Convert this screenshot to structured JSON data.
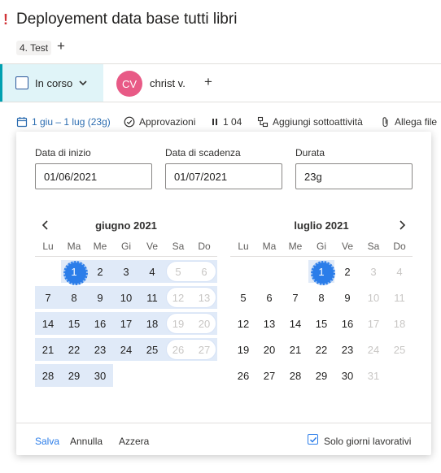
{
  "header": {
    "priority_mark": "!",
    "title": "Deployement data base tutti libri",
    "tag": "4. Test",
    "add_tag": "+"
  },
  "status": {
    "label": "In corso"
  },
  "assignee": {
    "initials": "CV",
    "name": "christ v.",
    "add": "+",
    "avatar_color": "#e85a86"
  },
  "toolbar": {
    "dates": "1 giu – 1 lug (23g)",
    "approvals": "Approvazioni",
    "count": "1 04",
    "add_subtask": "Aggiungi sottoattività",
    "attach": "Allega file"
  },
  "date_picker": {
    "start_label": "Data di inizio",
    "start_value": "01/06/2021",
    "due_label": "Data di scadenza",
    "due_value": "01/07/2021",
    "duration_label": "Durata",
    "duration_value": "23g",
    "weekdays": [
      "Lu",
      "Ma",
      "Me",
      "Gi",
      "Ve",
      "Sa",
      "Do"
    ],
    "months": [
      {
        "title": "giugno 2021",
        "first_weekday": 1,
        "days": 30,
        "days_in_prev_month": 0
      },
      {
        "title": "luglio 2021",
        "first_weekday": 3,
        "days": 31
      }
    ],
    "range": {
      "start": "2021-06-01",
      "end": "2021-07-01"
    },
    "footer": {
      "save": "Salva",
      "cancel": "Annulla",
      "reset": "Azzera",
      "workdays_only": "Solo giorni lavorativi",
      "workdays_checked": true
    }
  },
  "colors": {
    "accent": "#2b7de9",
    "range_fill": "#e0eaf8",
    "status_bg": "#e0f4f8"
  }
}
